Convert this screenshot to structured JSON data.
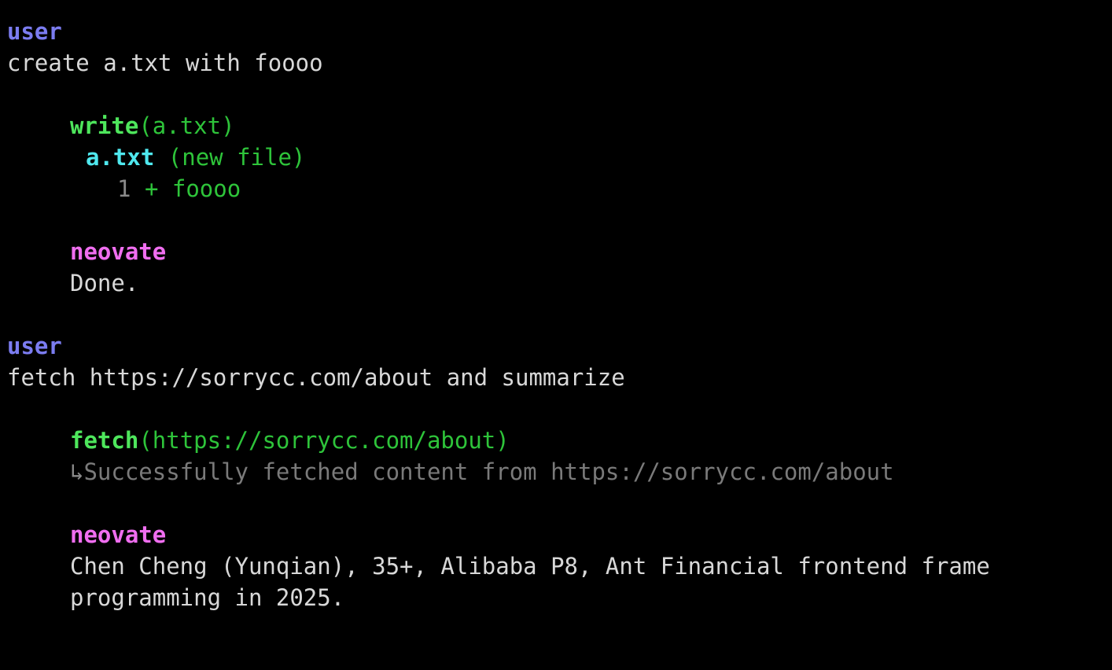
{
  "turns": [
    {
      "role": "user",
      "message": "create a.txt with foooo",
      "tool": {
        "name": "write",
        "arg": "(a.txt)",
        "file": "a.txt",
        "file_tag": "(new file)",
        "diff": {
          "line": "1",
          "text": "+ foooo"
        }
      },
      "reply_role": "neovate",
      "reply": "Done."
    },
    {
      "role": "user",
      "message": "fetch https://sorrycc.com/about and summarize",
      "tool": {
        "name": "fetch",
        "arg": "(https://sorrycc.com/about)",
        "result_arrow": "↳",
        "result": "Successfully fetched content from https://sorrycc.com/about"
      },
      "reply_role": "neovate",
      "reply_lines": [
        "Chen Cheng (Yunqian), 35+, Alibaba P8, Ant Financial frontend frame",
        "programming in 2025."
      ]
    }
  ],
  "colors": {
    "background": "#000000",
    "user": "#7b7cf0",
    "assistant": "#f06ef0",
    "tool_name": "#4ee65c",
    "tool_arg": "#2ec43a",
    "file_name": "#4fe8ee",
    "muted": "#7a7a7a",
    "text": "#d8d8d8"
  }
}
